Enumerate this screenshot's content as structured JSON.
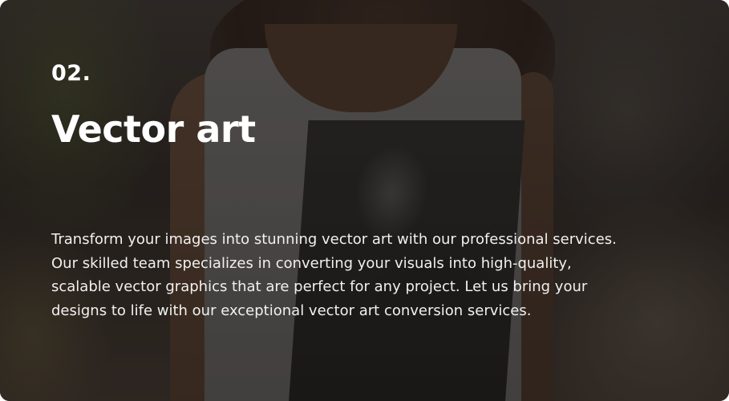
{
  "card": {
    "number": "02.",
    "title": "Vector art",
    "description_lines": [
      "Transform your images into stunning vector art with our professional services.",
      "Our skilled team specializes in converting your visuals into high-quality,",
      "scalable vector graphics that are perfect for any project. Let us bring your",
      "designs to life with our exceptional vector art conversion services."
    ]
  },
  "colors": {
    "text": "#ffffff",
    "overlay": "#14100e"
  }
}
